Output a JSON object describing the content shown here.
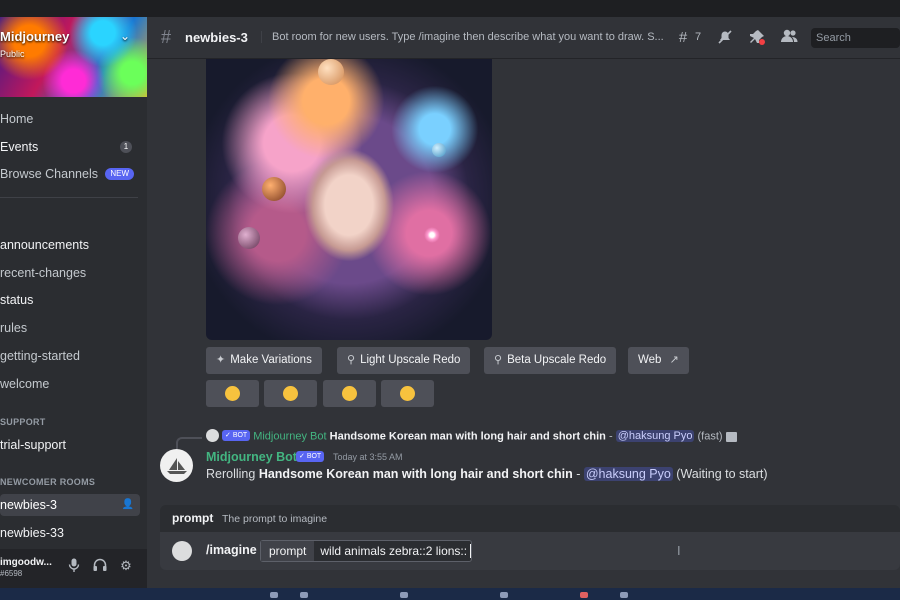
{
  "server": {
    "name": "Midjourney",
    "subtitle": "Public"
  },
  "sidebar": {
    "top_items": [
      {
        "label": "Home"
      },
      {
        "label": "Events",
        "badge": "1"
      },
      {
        "label": "Browse Channels",
        "badge": "NEW"
      }
    ],
    "info_items": [
      {
        "label": "announcements"
      },
      {
        "label": "recent-changes"
      },
      {
        "label": "status"
      },
      {
        "label": "rules"
      },
      {
        "label": "getting-started"
      },
      {
        "label": "welcome"
      }
    ],
    "support_category": "SUPPORT",
    "support_items": [
      {
        "label": "trial-support"
      }
    ],
    "newcomer_category": "NEWCOMER ROOMS",
    "newcomer_items": [
      {
        "label": "newbies-3"
      },
      {
        "label": "newbies-33"
      }
    ]
  },
  "user": {
    "name": "imgoodw...",
    "tag": "#6598"
  },
  "header": {
    "channel": "newbies-3",
    "topic": "Bot room for new users. Type /imagine then describe what you want to draw. S...",
    "thread_count": "7",
    "search_placeholder": "Search"
  },
  "buttons": [
    {
      "label": "Make Variations",
      "icon": "sparkle-icon"
    },
    {
      "label": "Light Upscale Redo",
      "icon": "magnifier-icon"
    },
    {
      "label": "Beta Upscale Redo",
      "icon": "magnifier-icon"
    },
    {
      "label": "Web",
      "icon": "external-link-icon"
    }
  ],
  "reactions": [
    "weary-face",
    "unamused-face",
    "grinning-face",
    "heart-eyes-face"
  ],
  "reply": {
    "author": "Midjourney Bot",
    "bot_tag": "BOT",
    "prompt": "Handsome Korean man with long hair and short chin",
    "separator": " - ",
    "mention": "@haksung Pyo",
    "mode": "(fast)"
  },
  "message": {
    "author": "Midjourney Bot",
    "bot_tag": "BOT",
    "time": "Today at 3:55 AM",
    "prefix": "Rerolling ",
    "prompt": "Handsome Korean man with long hair and short chin",
    "separator": " - ",
    "mention": "@haksung Pyo",
    "status": " (Waiting to start)"
  },
  "command": {
    "option_name": "prompt",
    "option_desc": "The prompt to imagine",
    "slash": "/imagine",
    "option_key": "prompt",
    "value": "wild animals zebra::2 lions::"
  },
  "colors": {
    "accent": "#5865f2",
    "bot_green": "#43b581",
    "bg": "#313338",
    "sidebar": "#2b2d31"
  }
}
